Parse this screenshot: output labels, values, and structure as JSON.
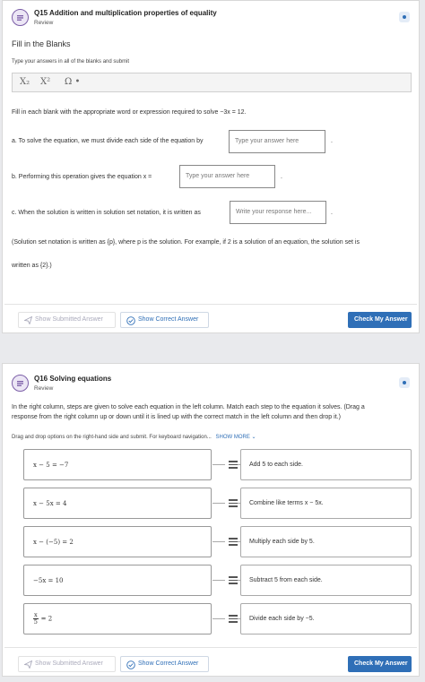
{
  "q15": {
    "title": "Q15 Addition and multiplication properties of equality",
    "subtitle": "Review",
    "heading": "Fill in the Blanks",
    "instructions": "Type your answers in all of the blanks and submit",
    "toolbar": {
      "subscript": "X₂",
      "superscript": "X²",
      "omega": "Ω •"
    },
    "prompt": "Fill in each blank with the appropriate word or expression required to solve −3x = 12.",
    "a_text": "a. To solve the equation, we must divide each side of the equation by",
    "a_placeholder": "Type your answer here",
    "b_text": "b. Performing this operation gives the equation x =",
    "b_placeholder": "Type your answer here",
    "c_text": "c. When the solution is written in solution set notation, it is written as",
    "c_placeholder": "Write your response here...",
    "period": ".",
    "note_line1": "(Solution set notation is written as {p}, where p is the solution. For example, if 2 is a solution of an equation, the solution set is",
    "note_line2": "written as {2}.)",
    "btn_submitted": "Show Submitted Answer",
    "btn_correct": "Show Correct Answer",
    "btn_check": "Check My Answer"
  },
  "q16": {
    "title": "Q16 Solving equations",
    "subtitle": "Review",
    "instructions_line1": "In the right column, steps are given to solve each equation in the left column. Match each step to the equation it solves. (Drag a",
    "instructions_line2": "response from the right column up or down until it is lined up with the correct match in the left column and then drop it.)",
    "dragnote": "Drag and drop options on the right-hand side and submit. For keyboard navigation...",
    "show_more": "SHOW MORE",
    "left": [
      "x − 5 = −7",
      "x − 5x = 4",
      "x − (−5) = 2",
      "−5x = 10",
      "= 2"
    ],
    "frac_num": "x",
    "frac_den": "5",
    "right": [
      "Add 5 to each side.",
      "Combine like terms x − 5x.",
      "Multiply each side by 5.",
      "Subtract 5 from each side.",
      "Divide each side by −5."
    ],
    "btn_submitted": "Show Submitted Answer",
    "btn_correct": "Show Correct Answer",
    "btn_check": "Check My Answer"
  },
  "colors": {
    "accent": "#2f6fb7",
    "icon": "#7b5ea7"
  }
}
